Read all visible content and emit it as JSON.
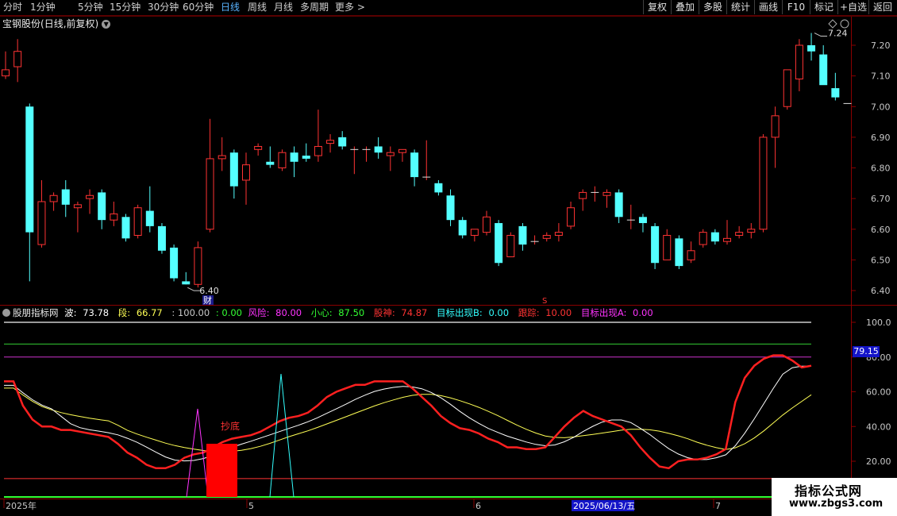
{
  "toolbar": {
    "periods": [
      "分时",
      "1分钟",
      "5分钟",
      "15分钟",
      "30分钟",
      "60分钟",
      "日线",
      "周线",
      "月线",
      "多周期",
      "更多 >"
    ],
    "active_period": "日线",
    "right_buttons": [
      "复权",
      "叠加",
      "多股",
      "统计",
      "画线",
      "F10",
      "标记",
      "+自选",
      "返回"
    ]
  },
  "stock": {
    "name": "宝钢股份",
    "mode": "(日线,前复权)",
    "high_label": "7.24",
    "low_label": "6.40",
    "marker_cai": "财",
    "marker_s": "S"
  },
  "price_axis": [
    "7.20",
    "7.10",
    "7.00",
    "6.90",
    "6.80",
    "6.70",
    "6.60",
    "6.50",
    "6.40"
  ],
  "indicator": {
    "name": "股朋指标网",
    "values": [
      {
        "label": "波:",
        "value": "73.78",
        "color": "#ffffff"
      },
      {
        "label": "段:",
        "value": "66.77",
        "color": "#ffff55"
      },
      {
        "label": "",
        "value": ": 100.00",
        "color": "#c8c8c8"
      },
      {
        "label": "",
        "value": ": 0.00",
        "color": "#33ff33"
      },
      {
        "label": "风险:",
        "value": "80.00",
        "color": "#ff33ff"
      },
      {
        "label": "小心:",
        "value": "87.50",
        "color": "#33ff33"
      },
      {
        "label": "股神:",
        "value": "74.87",
        "color": "#ff3333"
      },
      {
        "label": "目标出现B:",
        "value": "0.00",
        "color": "#33ffff"
      },
      {
        "label": "跟踪:",
        "value": "10.00",
        "color": "#ff3333"
      },
      {
        "label": "目标出现A:",
        "value": "0.00",
        "color": "#ff33ff"
      }
    ],
    "signal_text": "抄底",
    "current_value": "79.15",
    "axis": [
      "100.0",
      "80.00",
      "60.00",
      "40.00",
      "20.00"
    ]
  },
  "date_axis": {
    "labels": [
      "2025年",
      "5",
      "6",
      "7"
    ],
    "cursor_date": "2025/06/13/五"
  },
  "watermark": {
    "line1": "指标公式网",
    "line2": "www.zbgs3.com"
  },
  "colors": {
    "up": "#ff3333",
    "down": "#54ffff",
    "background": "#000000",
    "active_tab": "#5ab4ff"
  },
  "candles": [
    {
      "o": 7.1,
      "h": 7.18,
      "l": 7.09,
      "c": 7.12
    },
    {
      "o": 7.13,
      "h": 7.22,
      "l": 7.08,
      "c": 7.18
    },
    {
      "o": 7.0,
      "h": 7.01,
      "l": 6.43,
      "c": 6.59
    },
    {
      "o": 6.55,
      "h": 6.76,
      "l": 6.54,
      "c": 6.69
    },
    {
      "o": 6.69,
      "h": 6.72,
      "l": 6.66,
      "c": 6.71
    },
    {
      "o": 6.73,
      "h": 6.76,
      "l": 6.64,
      "c": 6.68
    },
    {
      "o": 6.67,
      "h": 6.69,
      "l": 6.59,
      "c": 6.68
    },
    {
      "o": 6.7,
      "h": 6.73,
      "l": 6.65,
      "c": 6.71
    },
    {
      "o": 6.72,
      "h": 6.73,
      "l": 6.6,
      "c": 6.63
    },
    {
      "o": 6.63,
      "h": 6.69,
      "l": 6.61,
      "c": 6.65
    },
    {
      "o": 6.64,
      "h": 6.65,
      "l": 6.56,
      "c": 6.57
    },
    {
      "o": 6.58,
      "h": 6.68,
      "l": 6.57,
      "c": 6.67
    },
    {
      "o": 6.66,
      "h": 6.74,
      "l": 6.59,
      "c": 6.61
    },
    {
      "o": 6.61,
      "h": 6.62,
      "l": 6.52,
      "c": 6.53
    },
    {
      "o": 6.54,
      "h": 6.55,
      "l": 6.43,
      "c": 6.44
    },
    {
      "o": 6.43,
      "h": 6.46,
      "l": 6.42,
      "c": 6.42
    },
    {
      "o": 6.42,
      "h": 6.56,
      "l": 6.41,
      "c": 6.54
    },
    {
      "o": 6.6,
      "h": 6.96,
      "l": 6.59,
      "c": 6.83
    },
    {
      "o": 6.83,
      "h": 6.9,
      "l": 6.79,
      "c": 6.84
    },
    {
      "o": 6.85,
      "h": 6.86,
      "l": 6.7,
      "c": 6.74
    },
    {
      "o": 6.76,
      "h": 6.85,
      "l": 6.68,
      "c": 6.81
    },
    {
      "o": 6.86,
      "h": 6.88,
      "l": 6.84,
      "c": 6.87
    },
    {
      "o": 6.82,
      "h": 6.87,
      "l": 6.8,
      "c": 6.81
    },
    {
      "o": 6.8,
      "h": 6.86,
      "l": 6.79,
      "c": 6.85
    },
    {
      "o": 6.85,
      "h": 6.87,
      "l": 6.77,
      "c": 6.82
    },
    {
      "o": 6.84,
      "h": 6.88,
      "l": 6.82,
      "c": 6.83
    },
    {
      "o": 6.84,
      "h": 6.99,
      "l": 6.82,
      "c": 6.87
    },
    {
      "o": 6.88,
      "h": 6.91,
      "l": 6.85,
      "c": 6.89
    },
    {
      "o": 6.9,
      "h": 6.92,
      "l": 6.86,
      "c": 6.87
    },
    {
      "o": 6.86,
      "h": 6.87,
      "l": 6.78,
      "c": 6.86
    },
    {
      "o": 6.86,
      "h": 6.87,
      "l": 6.82,
      "c": 6.86
    },
    {
      "o": 6.87,
      "h": 6.9,
      "l": 6.83,
      "c": 6.85
    },
    {
      "o": 6.84,
      "h": 6.87,
      "l": 6.79,
      "c": 6.85
    },
    {
      "o": 6.85,
      "h": 6.86,
      "l": 6.82,
      "c": 6.86
    },
    {
      "o": 6.85,
      "h": 6.86,
      "l": 6.74,
      "c": 6.77
    },
    {
      "o": 6.77,
      "h": 6.89,
      "l": 6.76,
      "c": 6.77
    },
    {
      "o": 6.75,
      "h": 6.76,
      "l": 6.71,
      "c": 6.72
    },
    {
      "o": 6.71,
      "h": 6.73,
      "l": 6.61,
      "c": 6.63
    },
    {
      "o": 6.63,
      "h": 6.64,
      "l": 6.57,
      "c": 6.58
    },
    {
      "o": 6.58,
      "h": 6.6,
      "l": 6.56,
      "c": 6.6
    },
    {
      "o": 6.59,
      "h": 6.66,
      "l": 6.58,
      "c": 6.64
    },
    {
      "o": 6.62,
      "h": 6.63,
      "l": 6.48,
      "c": 6.49
    },
    {
      "o": 6.51,
      "h": 6.59,
      "l": 6.51,
      "c": 6.58
    },
    {
      "o": 6.61,
      "h": 6.62,
      "l": 6.53,
      "c": 6.55
    },
    {
      "o": 6.56,
      "h": 6.58,
      "l": 6.55,
      "c": 6.56
    },
    {
      "o": 6.57,
      "h": 6.59,
      "l": 6.56,
      "c": 6.58
    },
    {
      "o": 6.58,
      "h": 6.62,
      "l": 6.56,
      "c": 6.59
    },
    {
      "o": 6.61,
      "h": 6.69,
      "l": 6.6,
      "c": 6.67
    },
    {
      "o": 6.7,
      "h": 6.73,
      "l": 6.66,
      "c": 6.72
    },
    {
      "o": 6.72,
      "h": 6.74,
      "l": 6.69,
      "c": 6.72
    },
    {
      "o": 6.71,
      "h": 6.73,
      "l": 6.67,
      "c": 6.72
    },
    {
      "o": 6.72,
      "h": 6.73,
      "l": 6.62,
      "c": 6.64
    },
    {
      "o": 6.63,
      "h": 6.68,
      "l": 6.6,
      "c": 6.63
    },
    {
      "o": 6.64,
      "h": 6.65,
      "l": 6.59,
      "c": 6.62
    },
    {
      "o": 6.61,
      "h": 6.62,
      "l": 6.47,
      "c": 6.49
    },
    {
      "o": 6.5,
      "h": 6.6,
      "l": 6.5,
      "c": 6.58
    },
    {
      "o": 6.57,
      "h": 6.58,
      "l": 6.47,
      "c": 6.48
    },
    {
      "o": 6.5,
      "h": 6.56,
      "l": 6.49,
      "c": 6.53
    },
    {
      "o": 6.55,
      "h": 6.6,
      "l": 6.54,
      "c": 6.59
    },
    {
      "o": 6.59,
      "h": 6.6,
      "l": 6.55,
      "c": 6.56
    },
    {
      "o": 6.56,
      "h": 6.63,
      "l": 6.55,
      "c": 6.57
    },
    {
      "o": 6.58,
      "h": 6.61,
      "l": 6.57,
      "c": 6.59
    },
    {
      "o": 6.59,
      "h": 6.62,
      "l": 6.57,
      "c": 6.6
    },
    {
      "o": 6.6,
      "h": 6.91,
      "l": 6.59,
      "c": 6.9
    },
    {
      "o": 6.9,
      "h": 7.0,
      "l": 6.8,
      "c": 6.97
    },
    {
      "o": 7.0,
      "h": 7.12,
      "l": 6.99,
      "c": 7.12
    },
    {
      "o": 7.09,
      "h": 7.22,
      "l": 7.05,
      "c": 7.2
    },
    {
      "o": 7.2,
      "h": 7.24,
      "l": 7.15,
      "c": 7.18
    },
    {
      "o": 7.17,
      "h": 7.2,
      "l": 7.09,
      "c": 7.07
    },
    {
      "o": 7.06,
      "h": 7.11,
      "l": 7.02,
      "c": 7.03
    },
    {
      "o": 7.01,
      "h": 7.01,
      "l": 7.01,
      "c": 7.01
    }
  ],
  "series_points": {
    "risk": 80,
    "caution": 87.5,
    "top_line": 100,
    "track": 10,
    "gushen": [
      66,
      66,
      52,
      44,
      40,
      40,
      38,
      38,
      37,
      36,
      35,
      34,
      30,
      25,
      22,
      18,
      16,
      16,
      18,
      22,
      24,
      25,
      28,
      31,
      33,
      34,
      35,
      37,
      40,
      43,
      45,
      46,
      48,
      52,
      57,
      60,
      62,
      64,
      64,
      66,
      66,
      66,
      66,
      62,
      57,
      52,
      46,
      42,
      39,
      38,
      36,
      33,
      31,
      28,
      28,
      27,
      27,
      28,
      34,
      40,
      45,
      49,
      46,
      44,
      42,
      40,
      35,
      28,
      22,
      17,
      16,
      20,
      21,
      21,
      22,
      24,
      27,
      54,
      68,
      75,
      79,
      81,
      81,
      78,
      74,
      75
    ]
  }
}
